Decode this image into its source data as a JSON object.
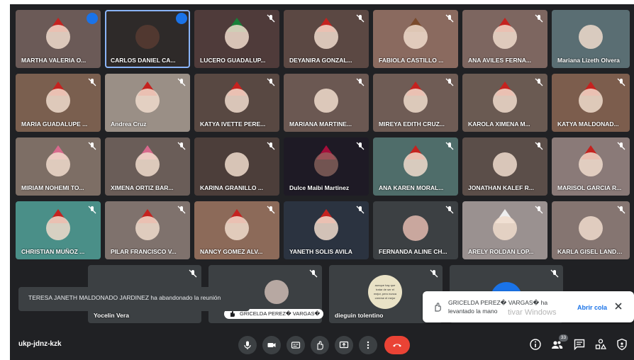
{
  "meeting": {
    "code": "ukp-jdnz-kzk",
    "participant_count": "33"
  },
  "participants": [
    {
      "name": "MARTHA VALERIA O..."
    },
    {
      "name": "CARLOS DANIEL CA..."
    },
    {
      "name": "LUCERO GUADALUP..."
    },
    {
      "name": "DEYANIRA GONZAL..."
    },
    {
      "name": "FABIOLA CASTILLO ..."
    },
    {
      "name": "ANA AVILES FERNA..."
    },
    {
      "name": "Mariana Lizeth Olvera"
    },
    {
      "name": "MARIA GUADALUPE ..."
    },
    {
      "name": "Andrea Cruz"
    },
    {
      "name": "KATYA IVETTE PERE..."
    },
    {
      "name": "MARIANA MARTINE..."
    },
    {
      "name": "MIREYA EDITH CRUZ..."
    },
    {
      "name": "KAROLA XIMENA M..."
    },
    {
      "name": "KATYA MALDONAD..."
    },
    {
      "name": "MIRIAM NOHEMI TO..."
    },
    {
      "name": "XIMENA ORTIZ BAR..."
    },
    {
      "name": "KARINA GRANILLO ..."
    },
    {
      "name": "Dulce Maibi Martinez"
    },
    {
      "name": "ANA KAREN MORAL..."
    },
    {
      "name": "JONATHAN KALEF R..."
    },
    {
      "name": "MARISOL GARCIA R..."
    },
    {
      "name": "CHRISTIAN MUÑOZ ..."
    },
    {
      "name": "PILAR FRANCISCO V..."
    },
    {
      "name": "NANCY GOMEZ ALV..."
    },
    {
      "name": "YANETH SOLIS AVILA"
    },
    {
      "name": "FERNANDA ALINE CH..."
    },
    {
      "name": "ARELY ROLDAN LOP..."
    },
    {
      "name": "KARLA GISEL LANDA..."
    },
    {
      "name": "Yocelin Vera"
    },
    {
      "name": "GRICELDA PEREZ� VARGAS�"
    },
    {
      "name": "dieguin tolentino"
    },
    {
      "name": ""
    }
  ],
  "notifications": {
    "left_meeting": "TERESA JANETH MALDONADO JARDINEZ ha abandonado la reunión",
    "hand_raised": "GRICELDA PEREZ� VARGAS� ha levantado la mano",
    "open_queue": "Abrir cola",
    "windows_watermark": "tivar Windows"
  },
  "presenter_chip": "GRICELDA PEREZ� VARGAS�",
  "tile_avatar_caption": "aunque hay que tratar de ser el mejor, pero nunca creerse el mejor",
  "colors": {
    "meet_bg": "#202124",
    "tile_bg": "#3c4043",
    "end_call": "#ea4335",
    "accent": "#1a73e8"
  },
  "icons": {
    "mic": "microphone-icon",
    "camera": "camera-icon",
    "captions": "captions-icon",
    "raise_hand": "raise-hand-icon",
    "present": "present-screen-icon",
    "more": "more-options-icon",
    "end_call": "end-call-icon",
    "info": "info-icon",
    "people": "people-icon",
    "chat": "chat-icon",
    "activities": "activities-icon",
    "security": "security-icon"
  }
}
